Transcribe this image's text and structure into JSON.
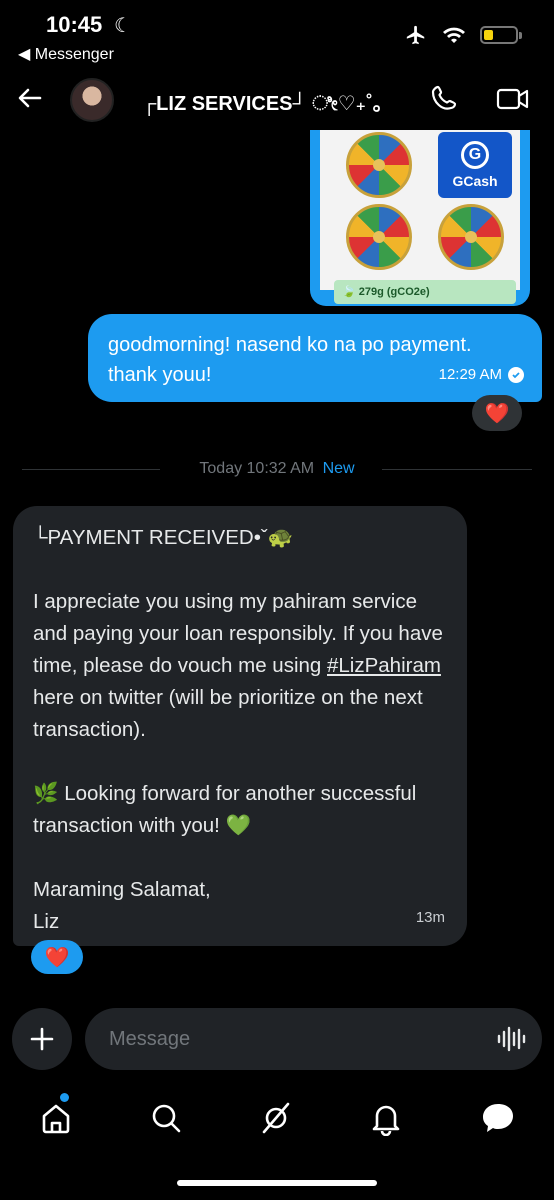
{
  "status_bar": {
    "time": "10:45",
    "back_app": "◀ Messenger"
  },
  "header": {
    "title": "┌LIZ SERVICES┘ ೀ♡₊˚｡"
  },
  "image_message": {
    "gcash_label": "GCash",
    "footer_text": "279g (gCO2e)"
  },
  "sent_message": {
    "text": "goodmorning! nasend ko na po payment. thank youu!",
    "time": "12:29 AM",
    "reaction": "❤️"
  },
  "divider": {
    "text": "Today 10:32 AM",
    "new_label": "New"
  },
  "received_message": {
    "heading": "└PAYMENT RECEIVED•ˇ🐢",
    "para1_before": "I appreciate you using my pahiram service and paying your loan responsibly. If you have time, please do vouch me using ",
    "hashtag": "#LizPahiram",
    "para1_after": " here on twitter (will be prioritize on the next transaction).",
    "para2": "🌿 Looking forward for another successful transaction with you! 💚",
    "closing_line1": "Maraming Salamat,",
    "closing_line2": "Liz",
    "time": "13m",
    "reaction": "❤️"
  },
  "composer": {
    "placeholder": "Message"
  },
  "icons": [
    "back-arrow-icon",
    "phone-icon",
    "video-icon",
    "plus-icon",
    "voice-icon",
    "home-icon",
    "search-icon",
    "grok-icon",
    "notifications-icon",
    "messages-icon"
  ],
  "colors": {
    "accent": "#1d9bf0",
    "bubble_received": "#202327",
    "background": "#000000"
  }
}
